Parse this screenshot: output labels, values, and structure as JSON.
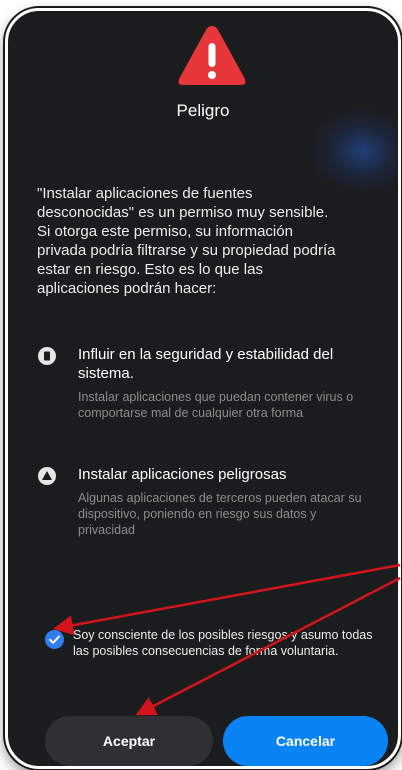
{
  "dialog": {
    "title": "Peligro",
    "intro": "\"Instalar aplicaciones de fuentes desconocidas\" es un permiso muy sensible. Si otorga este permiso, su información privada podría filtrarse y su propiedad podría estar en riesgo. Esto es lo que las aplicaciones podrán hacer:"
  },
  "permissions": [
    {
      "icon": "phone-icon",
      "title": "Influir en la seguridad y estabilidad del sistema.",
      "description": "Instalar aplicaciones que puedan contener virus o comportarse mal de cualquier otra forma"
    },
    {
      "icon": "warning-icon",
      "title": "Instalar aplicaciones peligrosas",
      "description": "Algunas aplicaciones de terceros pueden atacar su dispositivo, poniendo en riesgo sus datos y privacidad"
    }
  ],
  "consent": {
    "checked": true,
    "label": "Soy consciente de los posibles riesgos y asumo todas las posibles consecuencias de forma voluntaria."
  },
  "buttons": {
    "accept": "Aceptar",
    "cancel": "Cancelar"
  },
  "colors": {
    "background": "#1b1c1e",
    "warning_red": "#e8373a",
    "primary_blue": "#0a84f4",
    "checkbox_blue": "#2f7ef0",
    "annotation_arrow": "#d4141b"
  }
}
